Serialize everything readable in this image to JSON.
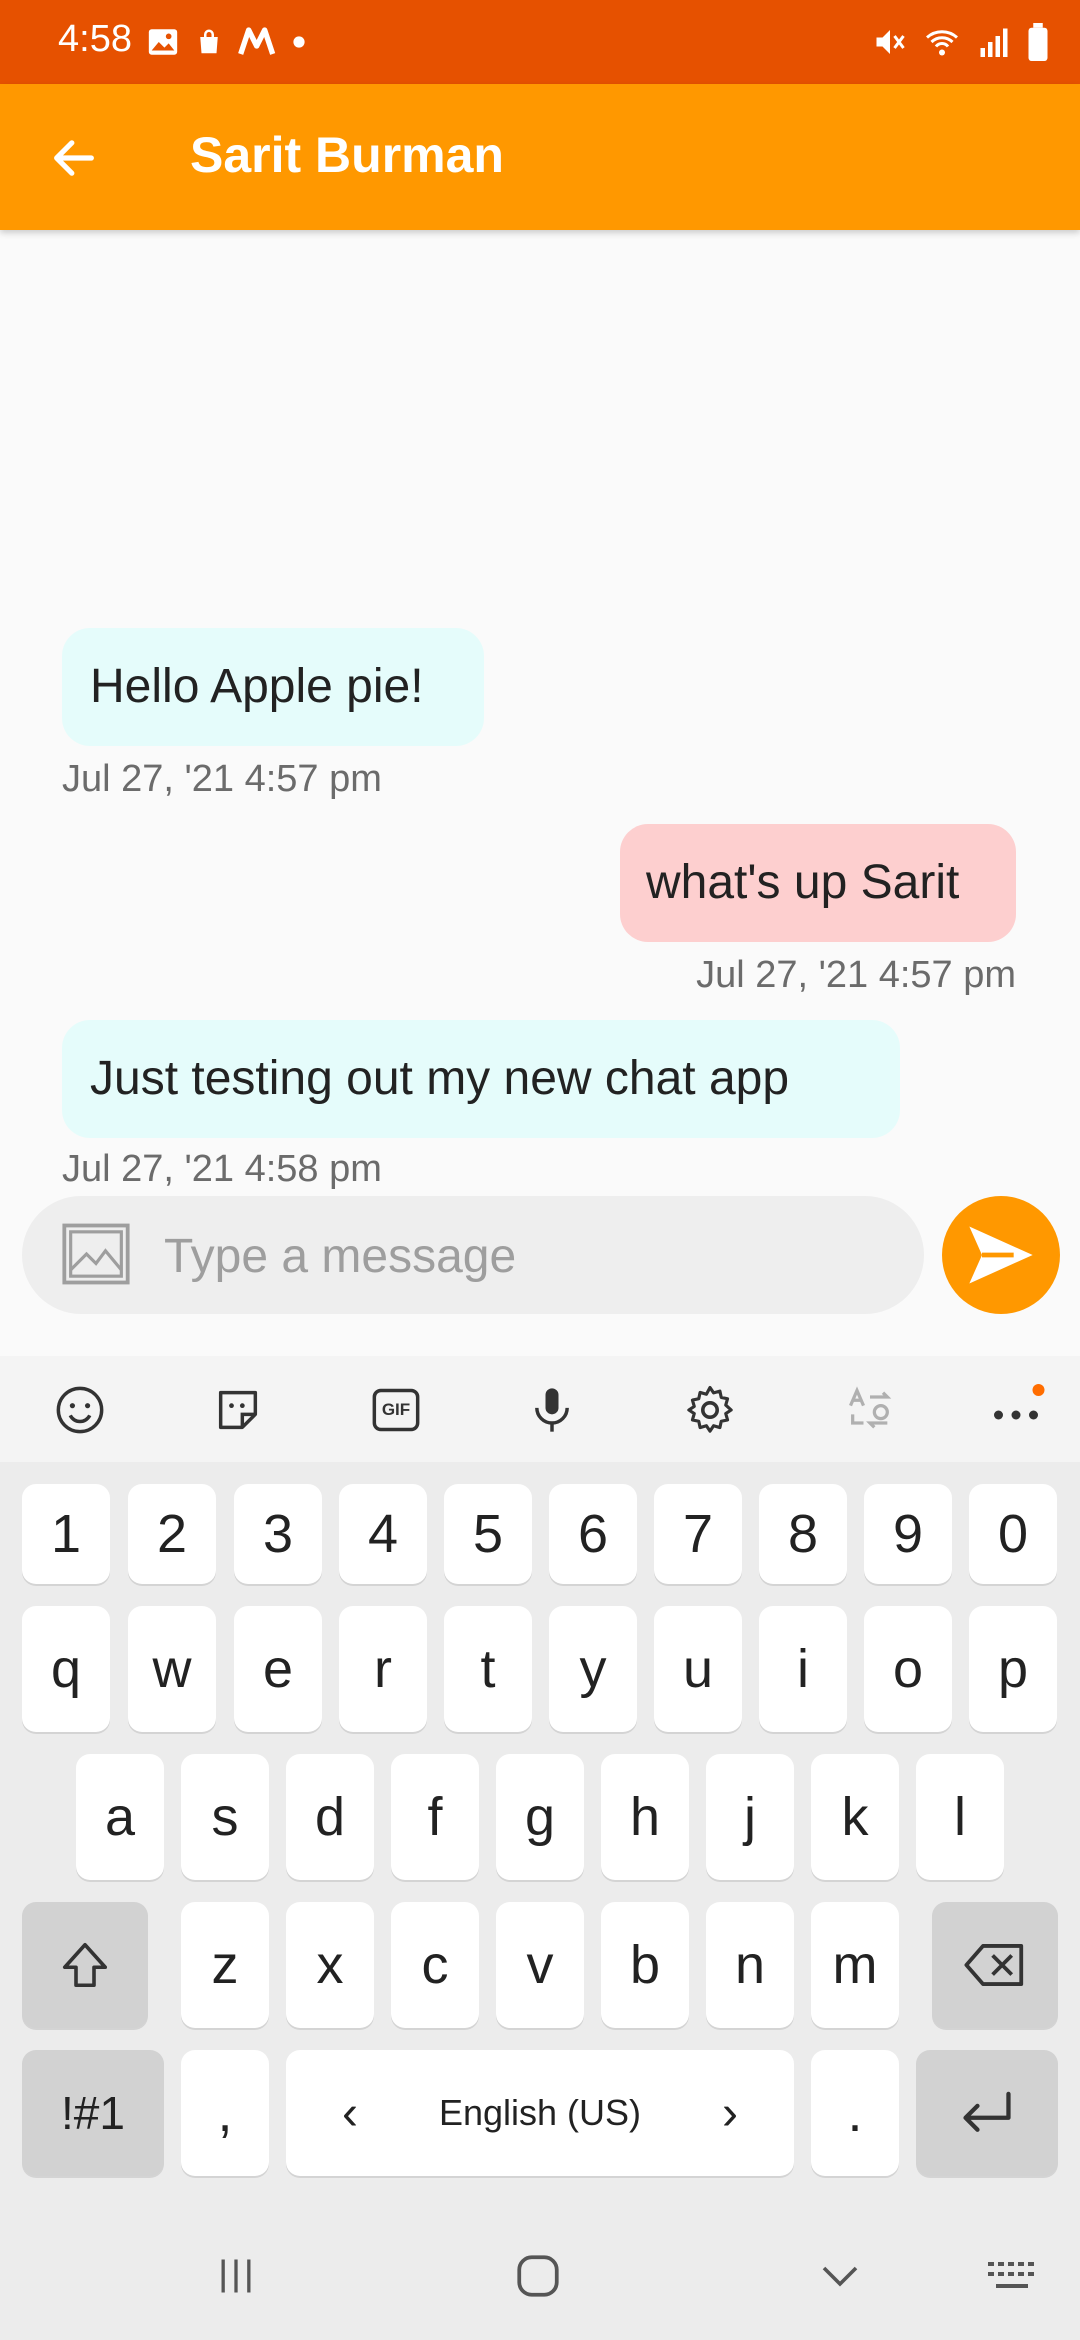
{
  "status_bar": {
    "time": "4:58",
    "left_icons": [
      "gallery-icon",
      "shopping-bag-icon",
      "m-app-icon",
      "dot-icon"
    ],
    "right_icons": [
      "mute-icon",
      "wifi-icon",
      "signal-icon",
      "battery-icon"
    ],
    "bg_color": "#e65100"
  },
  "app_bar": {
    "title": "Sarit Burman",
    "bg_color": "#ff9800"
  },
  "messages": [
    {
      "direction": "incoming",
      "text": "Hello Apple pie!",
      "timestamp": "Jul 27, '21 4:57 pm",
      "bubble_color": "#e5fcfb"
    },
    {
      "direction": "outgoing",
      "text": "what's up Sarit",
      "timestamp": "Jul 27, '21 4:57 pm",
      "bubble_color": "#fdcfcf"
    },
    {
      "direction": "incoming",
      "text": "Just testing out my new chat app",
      "timestamp": "Jul 27, '21 4:58 pm",
      "bubble_color": "#e5fcfb"
    }
  ],
  "composer": {
    "placeholder": "Type a message",
    "value": ""
  },
  "keyboard": {
    "toolbar": [
      "emoji-icon",
      "sticker-icon",
      "gif-icon",
      "microphone-icon",
      "gear-icon",
      "translate-icon",
      "more-icon"
    ],
    "gif_label": "GIF",
    "row_numbers": [
      "1",
      "2",
      "3",
      "4",
      "5",
      "6",
      "7",
      "8",
      "9",
      "0"
    ],
    "row_top": [
      "q",
      "w",
      "e",
      "r",
      "t",
      "y",
      "u",
      "i",
      "o",
      "p"
    ],
    "row_mid": [
      "a",
      "s",
      "d",
      "f",
      "g",
      "h",
      "j",
      "k",
      "l"
    ],
    "row_bottom": [
      "z",
      "x",
      "c",
      "v",
      "b",
      "n",
      "m"
    ],
    "symbols_label": "!#1",
    "comma_label": ",",
    "space_label": "English (US)",
    "lang_prev": "‹",
    "lang_next": "›",
    "period_label": "."
  }
}
